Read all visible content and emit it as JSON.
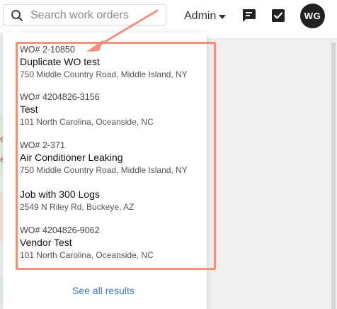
{
  "search": {
    "placeholder": "Search work orders"
  },
  "header": {
    "admin_label": "Admin",
    "avatar_initials": "WG"
  },
  "results": [
    {
      "wo_number": "WO# 2-10850",
      "title": "Duplicate WO test",
      "address": "750 Middle Country Road, Middle Island, NY"
    },
    {
      "wo_number": "WO# 4204826-3156",
      "title": "Test",
      "address": "101 North Carolina, Oceanside, NC"
    },
    {
      "wo_number": "WO# 2-371",
      "title": "Air Conditioner Leaking",
      "address": "750 Middle Country Road, Middle Island, NY"
    },
    {
      "wo_number": "",
      "title": "Job with 300 Logs",
      "address": "2549 N Riley Rd, Buckeye, AZ"
    },
    {
      "wo_number": "WO# 4204826-9062",
      "title": "Vendor Test",
      "address": "101 North Carolina, Oceanside, NC"
    }
  ],
  "footer": {
    "see_all_label": "See all results"
  },
  "colors": {
    "annotation": "#f2907c",
    "link": "#3a7bc8",
    "avatar_bg": "#222222"
  }
}
